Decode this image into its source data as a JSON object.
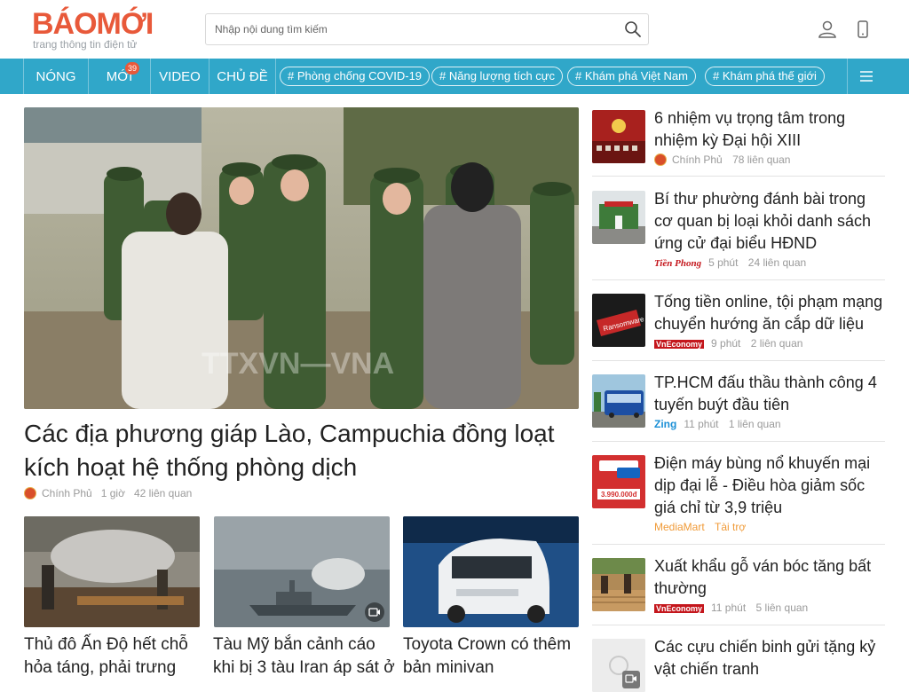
{
  "header": {
    "logo_main": "BÁOMỚI",
    "logo_sub": "trang thông tin điện tử",
    "search_placeholder": "Nhập nội dung tìm kiếm"
  },
  "nav": {
    "hot": "NÓNG",
    "new": "MỚI",
    "new_count": "39",
    "video": "VIDEO",
    "topics_label": "CHỦ ĐỀ",
    "topics": [
      "# Phòng chống COVID-19",
      "# Năng lượng tích cực",
      "# Khám phá Việt Nam",
      "# Khám phá thế giới"
    ]
  },
  "hero": {
    "title": "Các địa phương giáp Lào, Campuchia đồng loạt kích hoạt hệ thống phòng dịch",
    "source": "Chính Phủ",
    "time": "1 giờ",
    "related": "42 liên quan"
  },
  "cards": [
    {
      "title": "Thủ đô Ấn Độ hết chỗ hỏa táng, phải trưng"
    },
    {
      "title": "Tàu Mỹ bắn cảnh cáo khi bị 3 tàu Iran áp sát ở"
    },
    {
      "title": "Toyota Crown có thêm bản minivan"
    }
  ],
  "side": [
    {
      "title": "6 nhiệm vụ trọng tâm trong nhiệm kỳ Đại hội XIII",
      "source": "Chính Phủ",
      "time": "",
      "related": "78 liên quan"
    },
    {
      "title": "Bí thư phường đánh bài trong cơ quan bị loại khỏi danh sách ứng cử đại biểu HĐND",
      "source": "Tiền Phong",
      "time": "5 phút",
      "related": "24 liên quan"
    },
    {
      "title": "Tống tiền online, tội phạm mạng chuyển hướng ăn cắp dữ liệu",
      "source": "VnEconomy",
      "time": "9 phút",
      "related": "2 liên quan"
    },
    {
      "title": "TP.HCM đấu thầu thành công 4 tuyến buýt đầu tiên",
      "source": "Zing",
      "time": "11 phút",
      "related": "1 liên quan"
    },
    {
      "title": "Điện máy bùng nổ khuyến mại dịp đại lễ - Điều hòa giảm sốc giá chỉ từ 3,9 triệu",
      "source": "MediaMart",
      "time": "",
      "related": "Tài trợ"
    },
    {
      "title": "Xuất khẩu gỗ ván bóc tăng bất thường",
      "source": "VnEconomy",
      "time": "11 phút",
      "related": "5 liên quan"
    },
    {
      "title": "Các cựu chiến binh gửi tặng kỷ vật chiến tranh",
      "source": "",
      "time": "",
      "related": ""
    }
  ],
  "colors": {
    "brand": "#e8593a",
    "nav": "#30a7c9"
  }
}
